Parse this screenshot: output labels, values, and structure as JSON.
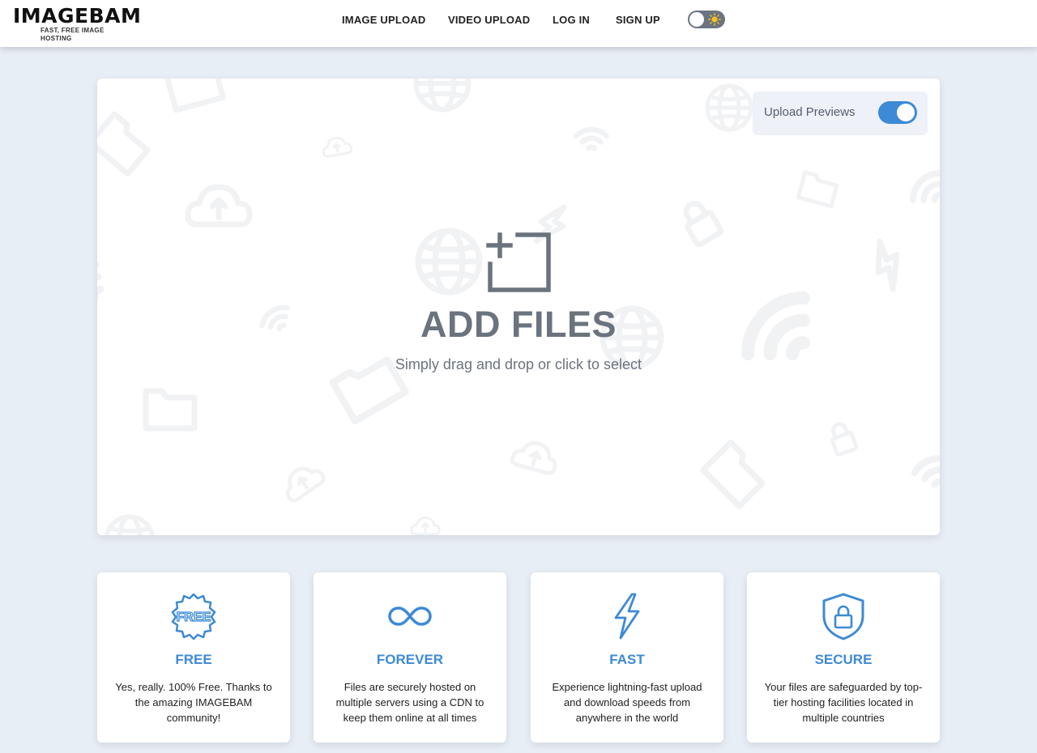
{
  "header": {
    "logo_main": "IMAGEBAM",
    "logo_sub": "FAST, FREE IMAGE HOSTING",
    "nav": [
      "IMAGE UPLOAD",
      "VIDEO UPLOAD",
      "LOG IN",
      "SIGN UP"
    ],
    "theme_toggle_icon": "sun-icon"
  },
  "upload": {
    "previews_label": "Upload Previews",
    "previews_enabled": true,
    "title": "ADD FILES",
    "subtitle": "Simply drag and drop or click to select",
    "icon": "add-files-icon"
  },
  "features": [
    {
      "icon": "free-badge-icon",
      "badge_text": "FREE",
      "title": "FREE",
      "text": "Yes, really. 100% Free. Thanks to the amazing IMAGEBAM community!"
    },
    {
      "icon": "infinity-icon",
      "title": "FOREVER",
      "text": "Files are securely hosted on multiple servers using a CDN to keep them online at all times"
    },
    {
      "icon": "lightning-icon",
      "title": "FAST",
      "text": "Experience lightning-fast upload and download speeds from anywhere in the world"
    },
    {
      "icon": "shield-lock-icon",
      "title": "SECURE",
      "text": "Your files are safeguarded by top-tier hosting facilities located in multiple countries"
    }
  ],
  "colors": {
    "accent": "#3d8ad6",
    "page_bg": "#e8eef6",
    "muted_text": "#6b737e"
  }
}
